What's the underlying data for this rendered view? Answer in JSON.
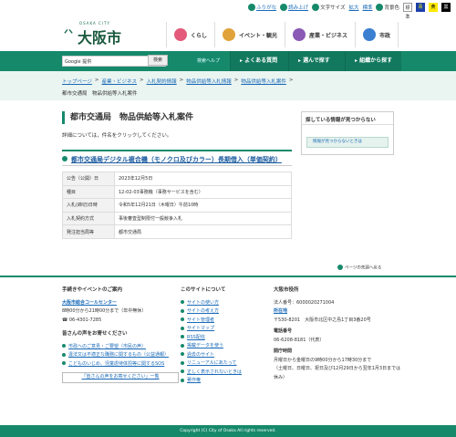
{
  "topbar": {
    "furigana": "ふりがな",
    "readaloud": "読み上げ",
    "textsize_label": "文字サイズ",
    "enlarge": "拡大",
    "standard": "標準",
    "bgcolor_label": "背景色",
    "bg_standard": "標準",
    "bg_blue": "青",
    "bg_yellow": "黄",
    "bg_black": "黒"
  },
  "logo": {
    "romaji": "OSAKA CITY",
    "name": "大阪市"
  },
  "gnav": [
    {
      "label": "くらし",
      "color": "#e35a7a"
    },
    {
      "label": "イベント・観光",
      "color": "#e0a23a"
    },
    {
      "label": "産業・ビジネス",
      "color": "#8a5ab5"
    },
    {
      "label": "市政",
      "color": "#3a7fd0"
    }
  ],
  "search": {
    "placeholder": "Google 提供",
    "button": "検索",
    "help": "検索ヘルプ"
  },
  "navbtns": [
    "よくある質問",
    "選んで探す",
    "組織から探す"
  ],
  "breadcrumb": {
    "items": [
      "トップページ",
      "産業・ビジネス",
      "入札契約情報",
      "物品供給等入札情報",
      "物品供給等入札案件"
    ],
    "current": "都市交通局　物品供給等入札案件"
  },
  "page": {
    "title": "都市交通局　物品供給等入札案件",
    "lead": "詳細については，件名をクリックしてください。",
    "subtitle": "都市交通局デジタル複合機（モノクロ及びカラー）長期借入（単価契約）",
    "table": [
      [
        "公告（公開）日",
        "2023年12月5日"
      ],
      [
        "種目",
        "12-02-03事務機（事務サービスを含む）"
      ],
      [
        "入札(締切)日時",
        "令和5年12月21日（木曜日）午前10時"
      ],
      [
        "入札契約方式",
        "事後審査型制限付一般競争入札"
      ],
      [
        "発注担当局等",
        "都市交通局"
      ]
    ],
    "pagetop": "ページの先頭へ戻る"
  },
  "aside": {
    "title": "探している情報が見つからない",
    "button": "情報が見つからないときは"
  },
  "footer": {
    "col1": {
      "title": "手続きやイベントのご案内",
      "center": "大阪市総合コールセンター",
      "hours": "8時00分から21時00分まで（年中無休）",
      "phone": "06-4301-7285",
      "voice_title": "皆さんの声をお寄せください",
      "links": [
        "市政へのご意見・ご要望（市民の声）",
        "違法又は不適正な職務に関するもの（公益通報）",
        "こどものいじめ、児童虐待体罰等に関するSOS"
      ],
      "box": "「皆さんの声をお寄せください」一覧"
    },
    "col2": {
      "title": "このサイトについて",
      "links": [
        "サイトの使い方",
        "サイトの考え方",
        "サイト管理者",
        "サイトマップ",
        "RSS配信",
        "掲載データを使う",
        "過去のサイト",
        "リニューアルにあたって",
        "正しく表示されないときは",
        "著作権"
      ]
    },
    "col3": {
      "title": "大阪市役所",
      "corp": "法人番号：6000020271004",
      "map": "所在地",
      "address": "〒530-8201　大阪市北区中之島1丁目3番20号",
      "tel_label": "電話番号",
      "tel": "06-6208-8181（代表）",
      "hours_label": "開庁時間",
      "hours1": "月曜日から金曜日の9時00分から17時30分まで",
      "hours2": "（土曜日、日曜日、祝日及び12月29日から翌年1月3日までは休み）"
    }
  },
  "copyright": "Copyright (C) City of Osaka All rights reserved."
}
